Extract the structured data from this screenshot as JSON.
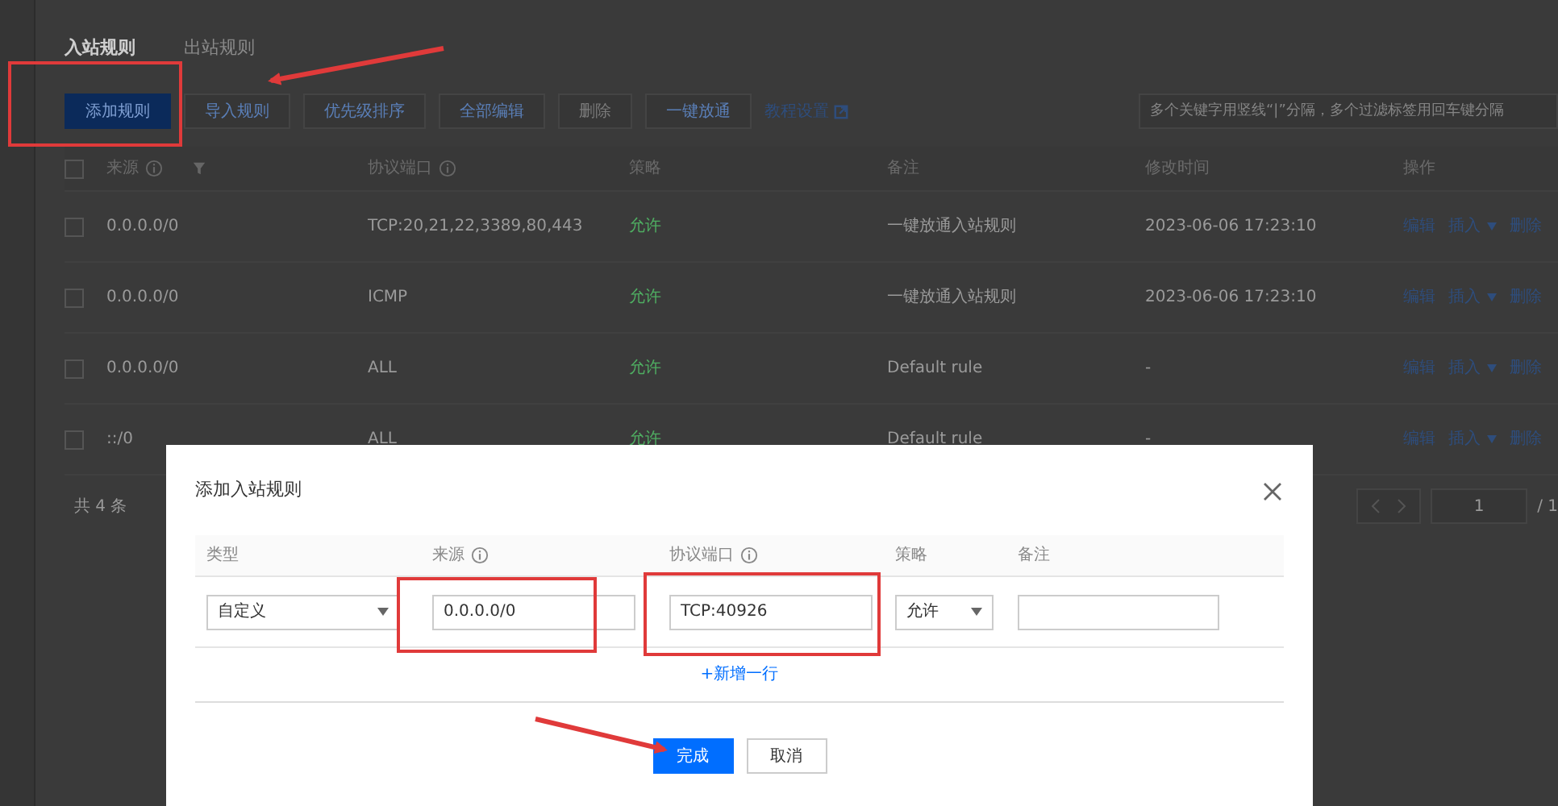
{
  "tabs": [
    {
      "label": "入站规则",
      "selected": true
    },
    {
      "label": "出站规则",
      "selected": false
    }
  ],
  "toolbar": {
    "buttons": [
      {
        "label": "添加规则",
        "kind": "primary",
        "disabled": false
      },
      {
        "label": "导入规则",
        "kind": "default",
        "disabled": false
      },
      {
        "label": "优先级排序",
        "kind": "default",
        "disabled": false
      },
      {
        "label": "全部编辑",
        "kind": "default",
        "disabled": false
      },
      {
        "label": "删除",
        "kind": "default",
        "disabled": true
      },
      {
        "label": "一键放通",
        "kind": "default",
        "disabled": false
      }
    ],
    "link": "教程设置",
    "search": {
      "placeholder": "多个关键字用竖线“|”分隔，多个过滤标签用回车键分隔"
    }
  },
  "table": {
    "columns": [
      {
        "label": "来源",
        "kind": "infofilter"
      },
      {
        "label": "协议端口",
        "kind": "info"
      },
      {
        "label": "策略",
        "kind": "plain"
      },
      {
        "label": "备注",
        "kind": "plain"
      },
      {
        "label": "修改时间",
        "kind": "plain"
      },
      {
        "label": "操作",
        "kind": "plain"
      }
    ],
    "all_checked": false,
    "rows": [
      {
        "checked": false,
        "source": "0.0.0.0/0",
        "port": "TCP:20,21,22,3389,80,443",
        "policy": "允许",
        "note": "一键放通入站规则",
        "modified": "2023-06-06 17:23:10",
        "actions": [
          "编辑",
          "插入",
          "删除"
        ]
      },
      {
        "checked": false,
        "source": "0.0.0.0/0",
        "port": "ICMP",
        "policy": "允许",
        "note": "一键放通入站规则",
        "modified": "2023-06-06 17:23:10",
        "actions": [
          "编辑",
          "插入",
          "删除"
        ]
      },
      {
        "checked": false,
        "source": "0.0.0.0/0",
        "port": "ALL",
        "policy": "允许",
        "note": "Default rule",
        "modified": "-",
        "actions": [
          "编辑",
          "插入",
          "删除"
        ]
      },
      {
        "checked": false,
        "source": "::/0",
        "port": "ALL",
        "policy": "允许",
        "note": "Default rule",
        "modified": "-",
        "actions": [
          "编辑",
          "插入",
          "删除"
        ]
      }
    ]
  },
  "footer": {
    "total": "共 4 条",
    "page": "1",
    "pages": "/ 1"
  },
  "modal": {
    "title": "添加入站规则",
    "columns": [
      {
        "label": "类型",
        "kind": "plain"
      },
      {
        "label": "来源",
        "kind": "info"
      },
      {
        "label": "协议端口",
        "kind": "info"
      },
      {
        "label": "策略",
        "kind": "plain"
      },
      {
        "label": "备注",
        "kind": "plain"
      }
    ],
    "row": {
      "type": "自定义",
      "source": "0.0.0.0/0",
      "port": "TCP:40926",
      "policy": "允许"
    },
    "add_row": "+新增一行",
    "buttons": [
      {
        "label": "完成",
        "kind": "primary"
      },
      {
        "label": "取消",
        "kind": "default"
      }
    ]
  }
}
